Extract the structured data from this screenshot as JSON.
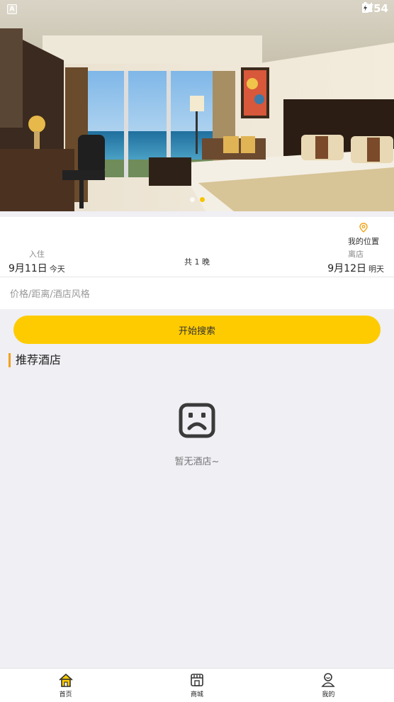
{
  "status_bar": {
    "time": "3:54",
    "app_icon": "A"
  },
  "banner": {
    "slides": 2,
    "active_slide": 2
  },
  "booking": {
    "location_label": "我的位置",
    "checkin": {
      "label": "入住",
      "date": "9月11日",
      "day": "今天"
    },
    "nights": "共 1 晚",
    "checkout": {
      "label": "离店",
      "date": "9月12日",
      "day": "明天"
    },
    "filter_placeholder": "价格/距离/酒店风格"
  },
  "search_button": "开始搜索",
  "recommend": {
    "title": "推荐酒店",
    "empty_text": "暂无酒店~"
  },
  "tabbar": {
    "items": [
      {
        "label": "首页",
        "icon": "home-icon",
        "active": true
      },
      {
        "label": "商城",
        "icon": "store-icon",
        "active": false
      },
      {
        "label": "我的",
        "icon": "user-icon",
        "active": false
      }
    ]
  },
  "colors": {
    "accent": "#fecb00",
    "section_bar": "#f1a21a",
    "background": "#efeff4"
  }
}
